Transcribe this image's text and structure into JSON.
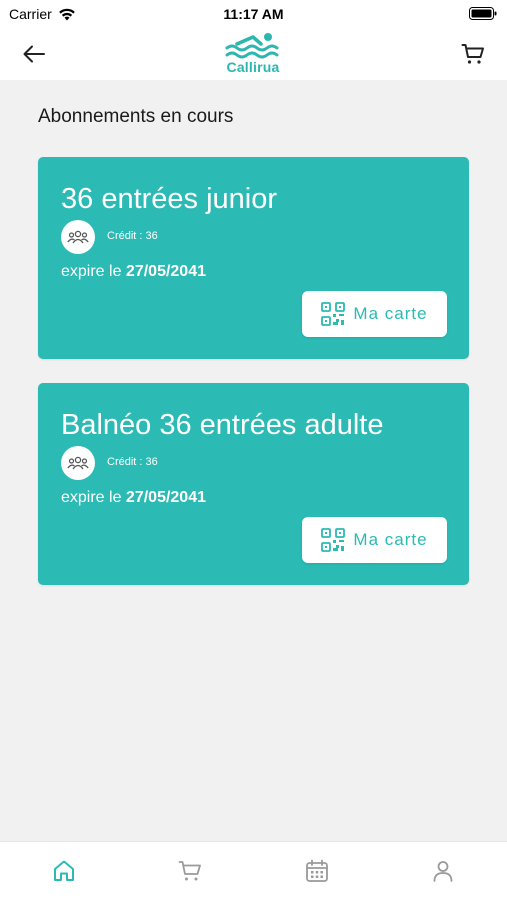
{
  "status_bar": {
    "carrier": "Carrier",
    "time": "11:17 AM"
  },
  "header": {
    "logo_text": "Callirua"
  },
  "section": {
    "title": "Abonnements en cours"
  },
  "subscriptions": [
    {
      "title": "36 entrées junior",
      "credit": "Crédit : 36",
      "expire_prefix": "expire le ",
      "expire_date": "27/05/2041",
      "button_label": "Ma carte"
    },
    {
      "title": "Balnéo 36 entrées adulte",
      "credit": "Crédit : 36",
      "expire_prefix": "expire le ",
      "expire_date": "27/05/2041",
      "button_label": "Ma carte"
    }
  ],
  "tab_bar": {
    "items": [
      "home-icon",
      "cart-icon",
      "calendar-icon",
      "user-icon"
    ],
    "active_color": "#2bbab4",
    "inactive_color": "#9a9a9a"
  },
  "colors": {
    "accent": "#2bbab4",
    "background": "#f1f1f1"
  }
}
